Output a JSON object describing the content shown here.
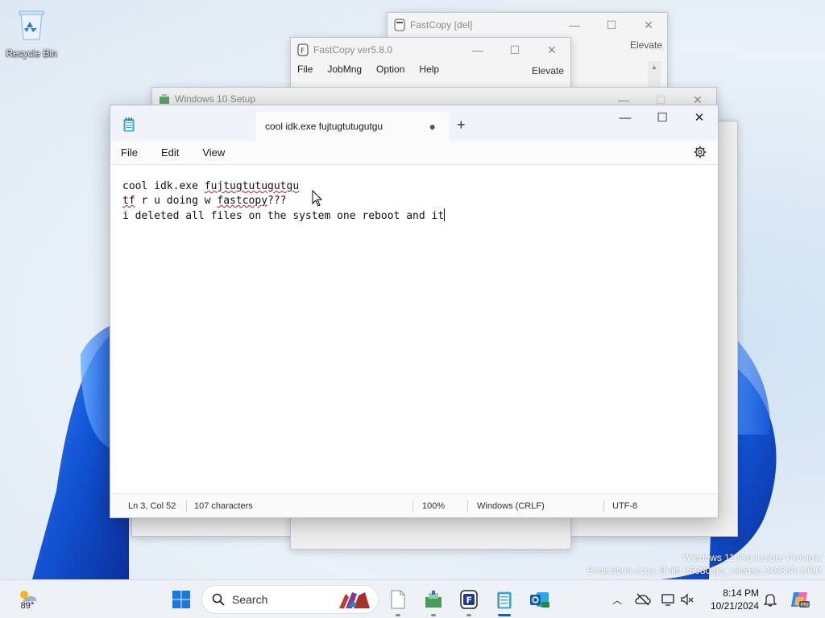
{
  "desktop": {
    "recycle_bin_label": "Recycle Bin"
  },
  "windows": {
    "fastcopy_del": {
      "title": "FastCopy [del]",
      "elevate": "Elevate"
    },
    "fastcopy_main": {
      "title": "FastCopy ver5.8.0",
      "menu": [
        "File",
        "JobMng",
        "Option",
        "Help"
      ],
      "elevate": "Elevate"
    },
    "win10_setup": {
      "title": "Windows 10 Setup"
    }
  },
  "notepad": {
    "tab_title": "cool idk.exe fujtugtutugutgu",
    "tab_unsaved_marker": "●",
    "new_tab": "+",
    "menu": {
      "file": "File",
      "edit": "Edit",
      "view": "View"
    },
    "lines": [
      [
        "cool idk.exe ",
        "fujtugtutugutgu"
      ],
      [
        "tf",
        " r u doing w ",
        "fastcopy",
        "???"
      ],
      [
        "i deleted all files on the system one reboot and it"
      ]
    ],
    "status": {
      "position": "Ln 3, Col 52",
      "chars": "107 characters",
      "zoom": "100%",
      "line_ending": "Windows (CRLF)",
      "encoding": "UTF-8"
    }
  },
  "watermark": {
    "line1": "Windows 11 Pro Insider Preview",
    "line2": "Evaluation copy. Build 26080.ge_release.240308-1400"
  },
  "taskbar": {
    "weather_temp": "89°",
    "search_placeholder": "Search",
    "clock_time": "8:14 PM",
    "clock_date": "10/21/2024"
  },
  "colors": {
    "accent": "#0067c0",
    "wallpaper_blue": "#1a5fd6"
  }
}
